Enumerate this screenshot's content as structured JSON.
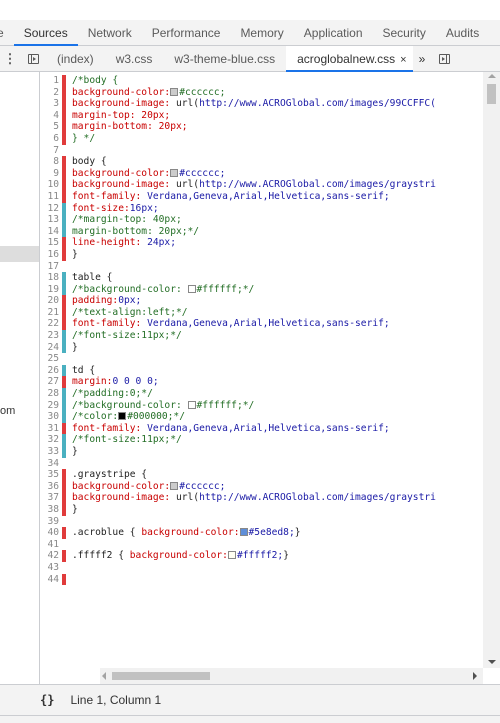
{
  "panel_tabs": [
    "e",
    "Sources",
    "Network",
    "Performance",
    "Memory",
    "Application",
    "Security",
    "Audits"
  ],
  "active_panel": "Sources",
  "source_tabs": [
    "(index)",
    "w3.css",
    "w3-theme-blue.css",
    "acroglobalnew.css"
  ],
  "active_source_tab": "acroglobalnew.css",
  "source_tab_close": "×",
  "more_tabs_label": "»",
  "navigator_fragment": "om",
  "status": {
    "braces": "{}",
    "cursor": "Line 1, Column 1"
  },
  "colors": {
    "accent": "#1a73e8",
    "gutter_red": "#e03b3b",
    "gutter_teal": "#4ab0c0"
  },
  "code_lines": [
    {
      "n": "1",
      "g": "red",
      "t": [
        [
          "com",
          "/*body {"
        ]
      ]
    },
    {
      "n": "2",
      "g": "red",
      "t": [
        [
          "prop",
          "background-color:"
        ],
        [
          "sw",
          "#cccccc"
        ],
        [
          "com",
          "#cccccc;"
        ]
      ]
    },
    {
      "n": "3",
      "g": "red",
      "t": [
        [
          "prop",
          "background-image: "
        ],
        [
          "fn",
          "url("
        ],
        [
          "url",
          "http://www.ACROGlobal.com/images/99CCFFC("
        ]
      ]
    },
    {
      "n": "4",
      "g": "red",
      "t": [
        [
          "prop",
          "margin-top: 20px;"
        ]
      ]
    },
    {
      "n": "5",
      "g": "red",
      "t": [
        [
          "prop",
          "margin-bottom: 20px;"
        ]
      ]
    },
    {
      "n": "6",
      "g": "red",
      "t": [
        [
          "com",
          "} */"
        ]
      ]
    },
    {
      "n": "7",
      "g": "none",
      "t": []
    },
    {
      "n": "8",
      "g": "red",
      "t": [
        [
          "sel",
          "body {"
        ]
      ]
    },
    {
      "n": "9",
      "g": "red",
      "t": [
        [
          "prop",
          "background-color:"
        ],
        [
          "sw",
          "#cccccc"
        ],
        [
          "val",
          "#cccccc;"
        ]
      ]
    },
    {
      "n": "10",
      "g": "red",
      "t": [
        [
          "prop",
          "background-image: "
        ],
        [
          "fn",
          "url("
        ],
        [
          "url",
          "http://www.ACROGlobal.com/images/graystri"
        ]
      ]
    },
    {
      "n": "11",
      "g": "red",
      "t": [
        [
          "prop",
          "font-family: "
        ],
        [
          "val",
          "Verdana,Geneva,Arial,Helvetica,sans-serif;"
        ]
      ]
    },
    {
      "n": "12",
      "g": "teal",
      "t": [
        [
          "prop",
          "font-size:"
        ],
        [
          "val",
          "16px;"
        ]
      ]
    },
    {
      "n": "13",
      "g": "teal",
      "t": [
        [
          "com",
          "/*margin-top: 40px;"
        ]
      ]
    },
    {
      "n": "14",
      "g": "teal",
      "t": [
        [
          "com",
          "margin-bottom: 20px;*/"
        ]
      ]
    },
    {
      "n": "15",
      "g": "red",
      "t": [
        [
          "prop",
          "line-height: "
        ],
        [
          "val",
          "24px;"
        ]
      ]
    },
    {
      "n": "16",
      "g": "red",
      "t": [
        [
          "sel",
          "}"
        ]
      ]
    },
    {
      "n": "17",
      "g": "none",
      "t": []
    },
    {
      "n": "18",
      "g": "teal",
      "t": [
        [
          "sel",
          "table {"
        ]
      ]
    },
    {
      "n": "19",
      "g": "teal",
      "t": [
        [
          "com",
          "/*background-color: "
        ],
        [
          "sw",
          "#ffffff"
        ],
        [
          "com",
          "#ffffff;*/"
        ]
      ]
    },
    {
      "n": "20",
      "g": "red",
      "t": [
        [
          "prop",
          "padding:"
        ],
        [
          "val",
          "0px;"
        ]
      ]
    },
    {
      "n": "21",
      "g": "red",
      "t": [
        [
          "com",
          "/*text-align:left;*/"
        ]
      ]
    },
    {
      "n": "22",
      "g": "red",
      "t": [
        [
          "prop",
          "font-family: "
        ],
        [
          "val",
          "Verdana,Geneva,Arial,Helvetica,sans-serif;"
        ]
      ]
    },
    {
      "n": "23",
      "g": "teal",
      "t": [
        [
          "com",
          "/*font-size:11px;*/"
        ]
      ]
    },
    {
      "n": "24",
      "g": "teal",
      "t": [
        [
          "sel",
          "}"
        ]
      ]
    },
    {
      "n": "25",
      "g": "none",
      "t": []
    },
    {
      "n": "26",
      "g": "teal",
      "t": [
        [
          "sel",
          "td {"
        ]
      ]
    },
    {
      "n": "27",
      "g": "red",
      "t": [
        [
          "prop",
          "margin:"
        ],
        [
          "val",
          "0 0 0 0;"
        ]
      ]
    },
    {
      "n": "28",
      "g": "teal",
      "t": [
        [
          "com",
          "/*padding:0;*/"
        ]
      ]
    },
    {
      "n": "29",
      "g": "teal",
      "t": [
        [
          "com",
          "/*background-color: "
        ],
        [
          "sw",
          "#ffffff"
        ],
        [
          "com",
          "#ffffff;*/"
        ]
      ]
    },
    {
      "n": "30",
      "g": "teal",
      "t": [
        [
          "com",
          "/*color:"
        ],
        [
          "sw",
          "#000000"
        ],
        [
          "com",
          "#000000;*/"
        ]
      ]
    },
    {
      "n": "31",
      "g": "red",
      "t": [
        [
          "prop",
          "font-family: "
        ],
        [
          "val",
          "Verdana,Geneva,Arial,Helvetica,sans-serif;"
        ]
      ]
    },
    {
      "n": "32",
      "g": "teal",
      "t": [
        [
          "com",
          "/*font-size:11px;*/"
        ]
      ]
    },
    {
      "n": "33",
      "g": "teal",
      "t": [
        [
          "sel",
          "}"
        ]
      ]
    },
    {
      "n": "34",
      "g": "none",
      "t": []
    },
    {
      "n": "35",
      "g": "red",
      "t": [
        [
          "sel",
          ".graystripe {"
        ]
      ]
    },
    {
      "n": "36",
      "g": "red",
      "t": [
        [
          "prop",
          "background-color:"
        ],
        [
          "sw",
          "#cccccc"
        ],
        [
          "val",
          "#cccccc;"
        ]
      ]
    },
    {
      "n": "37",
      "g": "red",
      "t": [
        [
          "prop",
          "background-image: "
        ],
        [
          "fn",
          "url("
        ],
        [
          "url",
          "http://www.ACROGlobal.com/images/graystri"
        ]
      ]
    },
    {
      "n": "38",
      "g": "red",
      "t": [
        [
          "sel",
          "}"
        ]
      ]
    },
    {
      "n": "39",
      "g": "none",
      "t": []
    },
    {
      "n": "40",
      "g": "red",
      "t": [
        [
          "sel",
          ".acroblue { "
        ],
        [
          "prop",
          "background-color:"
        ],
        [
          "sw",
          "#5e8ed8"
        ],
        [
          "val",
          "#5e8ed8;"
        ],
        [
          "sel",
          "}"
        ]
      ]
    },
    {
      "n": "41",
      "g": "none",
      "t": []
    },
    {
      "n": "42",
      "g": "red",
      "t": [
        [
          "sel",
          ".fffff2 { "
        ],
        [
          "prop",
          "background-color:"
        ],
        [
          "sw",
          "#fffff2"
        ],
        [
          "val",
          "#fffff2;"
        ],
        [
          "sel",
          "}"
        ]
      ]
    },
    {
      "n": "43",
      "g": "none",
      "t": []
    },
    {
      "n": "44",
      "g": "red",
      "t": []
    }
  ]
}
